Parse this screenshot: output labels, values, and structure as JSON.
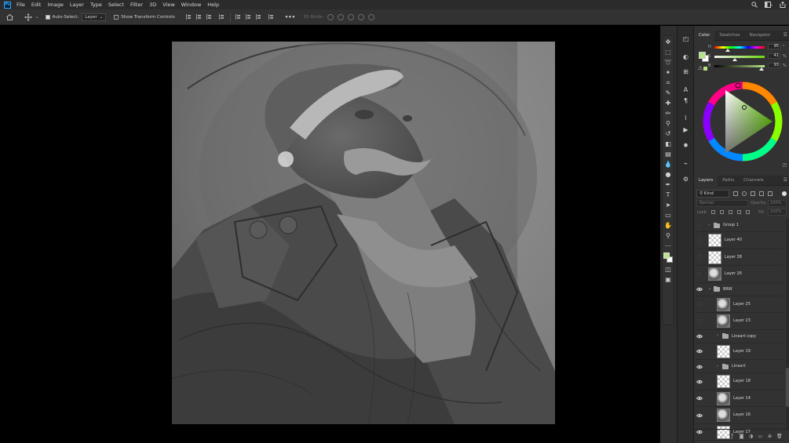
{
  "app": {
    "logo": "Ps",
    "menu": [
      "File",
      "Edit",
      "Image",
      "Layer",
      "Type",
      "Select",
      "Filter",
      "3D",
      "View",
      "Window",
      "Help"
    ]
  },
  "options_bar": {
    "auto_select_label": "Auto-Select:",
    "auto_select_checked": true,
    "auto_select_target": "Layer",
    "show_transform_label": "Show Transform Controls",
    "show_transform_checked": false,
    "more_label": "•••",
    "mode_3d_label": "3D Mode:"
  },
  "color_panel": {
    "tabs": [
      "Color",
      "Swatches",
      "Navigator"
    ],
    "active_tab": "Color",
    "sliders": [
      {
        "label": "H",
        "value": "95",
        "unit": "°",
        "fraction": 0.26
      },
      {
        "label": "S",
        "value": "41",
        "unit": "%",
        "fraction": 0.41
      },
      {
        "label": "B",
        "value": "93",
        "unit": "%",
        "fraction": 0.93
      }
    ],
    "foreground_color": "#b7e383",
    "background_color": "#ffffff"
  },
  "layers_panel": {
    "tabs": [
      "Layers",
      "Paths",
      "Channels"
    ],
    "active_tab": "Layers",
    "filter_kind": "Kind",
    "blend_mode": "Normal",
    "opacity_label": "Opacity:",
    "opacity_value": "100%",
    "lock_label": "Lock:",
    "fill_label": "Fill:",
    "fill_value": "100%",
    "layers": [
      {
        "name": "Group 1",
        "type": "group",
        "visible": false,
        "indent": 0,
        "expanded": false
      },
      {
        "name": "Layer 40",
        "type": "layer",
        "visible": false,
        "indent": 0,
        "thumb": "checker"
      },
      {
        "name": "Layer 38",
        "type": "layer",
        "visible": false,
        "indent": 0,
        "thumb": "checker"
      },
      {
        "name": "Layer 26",
        "type": "layer",
        "visible": false,
        "indent": 0,
        "thumb": "art"
      },
      {
        "name": "BRW",
        "type": "group",
        "visible": true,
        "indent": 0,
        "expanded": true
      },
      {
        "name": "Layer 25",
        "type": "layer",
        "visible": false,
        "indent": 1,
        "thumb": "art"
      },
      {
        "name": "Layer 23",
        "type": "layer",
        "visible": false,
        "indent": 1,
        "thumb": "art"
      },
      {
        "name": "Lineart copy",
        "type": "group",
        "visible": true,
        "indent": 1,
        "expanded": false
      },
      {
        "name": "Layer 19",
        "type": "layer",
        "visible": true,
        "indent": 1,
        "thumb": "checker"
      },
      {
        "name": "Lineart",
        "type": "group",
        "visible": true,
        "indent": 1,
        "expanded": false
      },
      {
        "name": "Layer 18",
        "type": "layer",
        "visible": true,
        "indent": 1,
        "thumb": "checker"
      },
      {
        "name": "Layer 14",
        "type": "layer",
        "visible": true,
        "indent": 1,
        "thumb": "art"
      },
      {
        "name": "Layer 16",
        "type": "layer",
        "visible": true,
        "indent": 1,
        "thumb": "art"
      },
      {
        "name": "Layer 17",
        "type": "layer",
        "visible": true,
        "indent": 1,
        "thumb": "checker"
      }
    ]
  }
}
